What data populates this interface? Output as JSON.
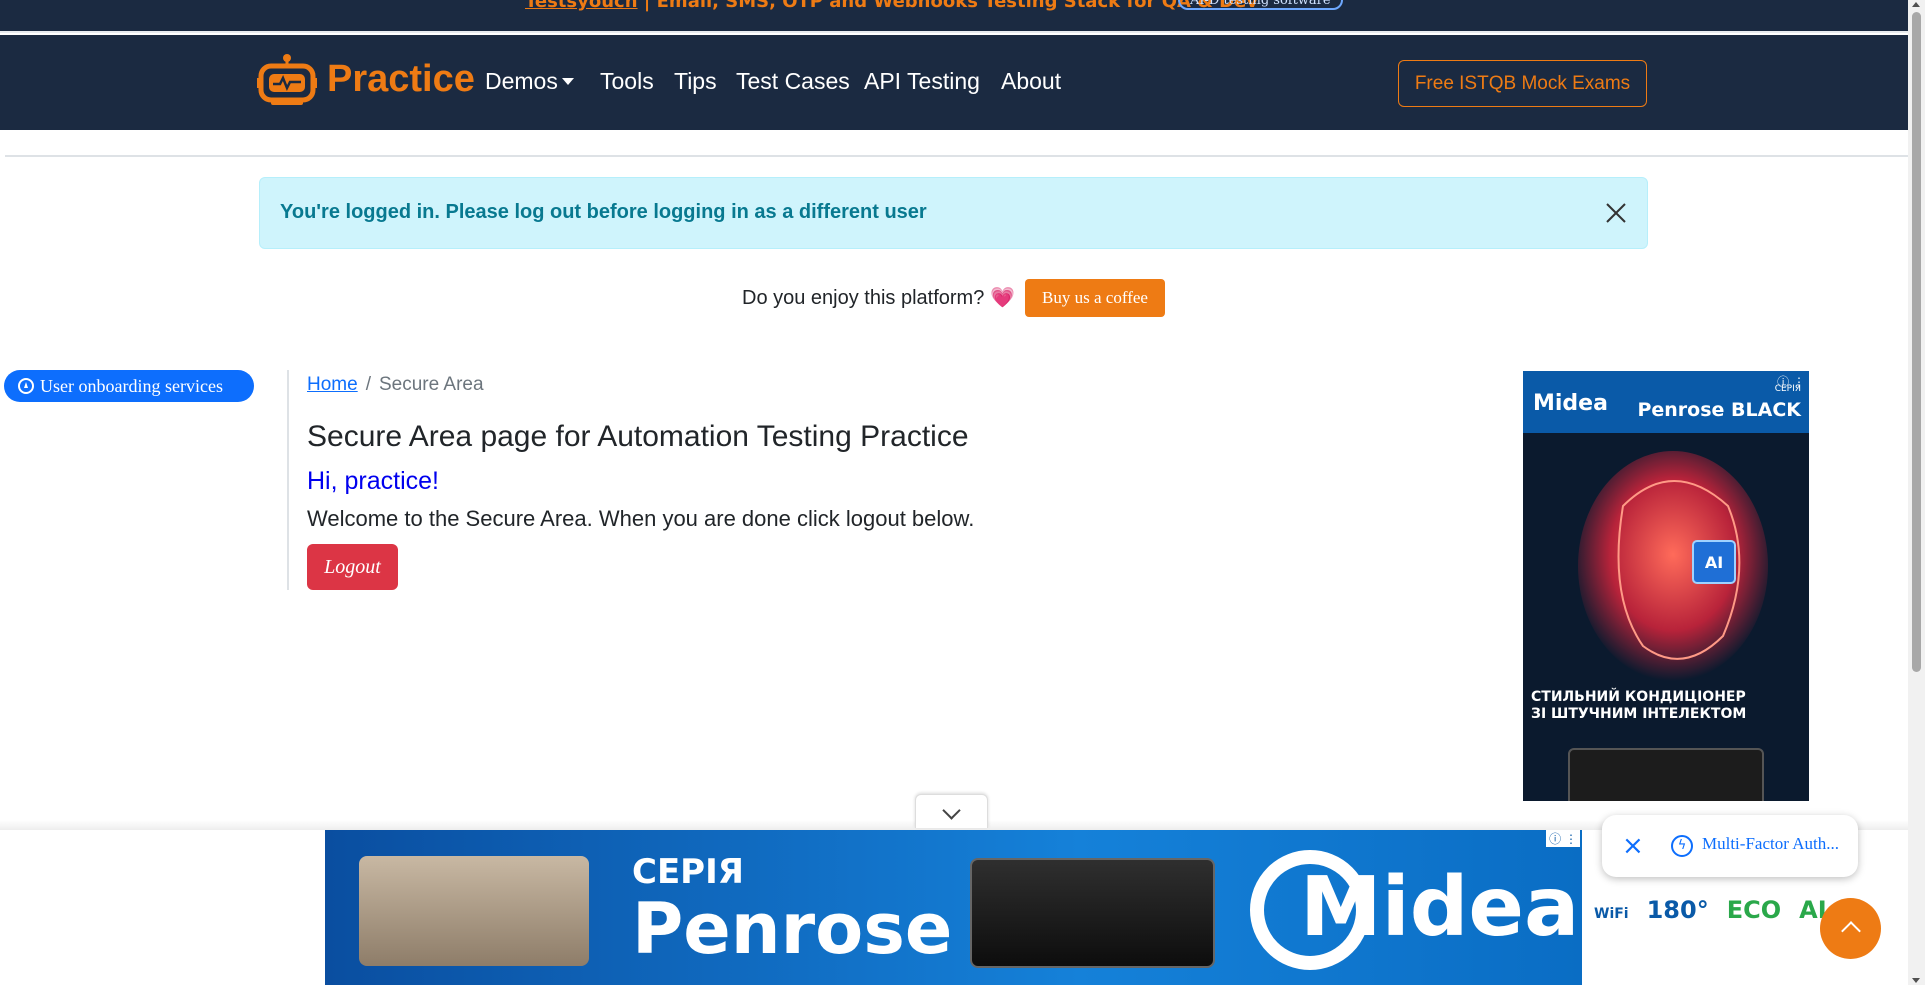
{
  "top_banner": {
    "promo_prefix": "Testsyouch",
    "promo_text": " | Email, SMS, OTP and Webhooks Testing Stack for QA & Dev",
    "pill_label": "AI-D testing software"
  },
  "navbar": {
    "brand": "Practice",
    "items": [
      "Demos",
      "Tools",
      "Tips",
      "Test Cases",
      "API Testing",
      "About"
    ],
    "cta_label": "Free ISTQB Mock Exams"
  },
  "alert": {
    "text": "You're logged in. Please log out before logging in as a different user"
  },
  "support": {
    "question": "Do you enjoy this platform?",
    "heart": "💗",
    "button_label": "Buy us a coffee"
  },
  "onboarding_label": "User onboarding services",
  "breadcrumb": {
    "home": "Home",
    "separator": "/",
    "current": "Secure Area"
  },
  "content": {
    "title": "Secure Area page for Automation Testing Practice",
    "greeting": "Hi, practice!",
    "welcome": "Welcome to the Secure Area. When you are done click logout below.",
    "logout_label": "Logout"
  },
  "side_ad": {
    "brand": "Midea",
    "series_small": "СЕРІЯ",
    "model": "Penrose BLACK",
    "tagline_1": "СТИЛЬНИЙ КОНДИЦІОНЕР",
    "tagline_2": "ЗІ ШТУЧНИМ ІНТЕЛЕКТОМ",
    "feature_icons": [
      "WiFi",
      "180°",
      "ECO",
      "AI"
    ],
    "info": "ⓘ ⋮"
  },
  "bottom_ad": {
    "series": "СЕРІЯ",
    "model": "Penrose",
    "brand": "Midea",
    "info": "ⓘ ⋮"
  },
  "notification": {
    "text": "Multi-Factor Auth..."
  },
  "colors": {
    "navy": "#1b2a41",
    "orange": "#ee7b14",
    "alert_bg": "#cff4fc",
    "alert_text": "#087990",
    "danger": "#dc3545",
    "primary": "#0d6efd"
  }
}
